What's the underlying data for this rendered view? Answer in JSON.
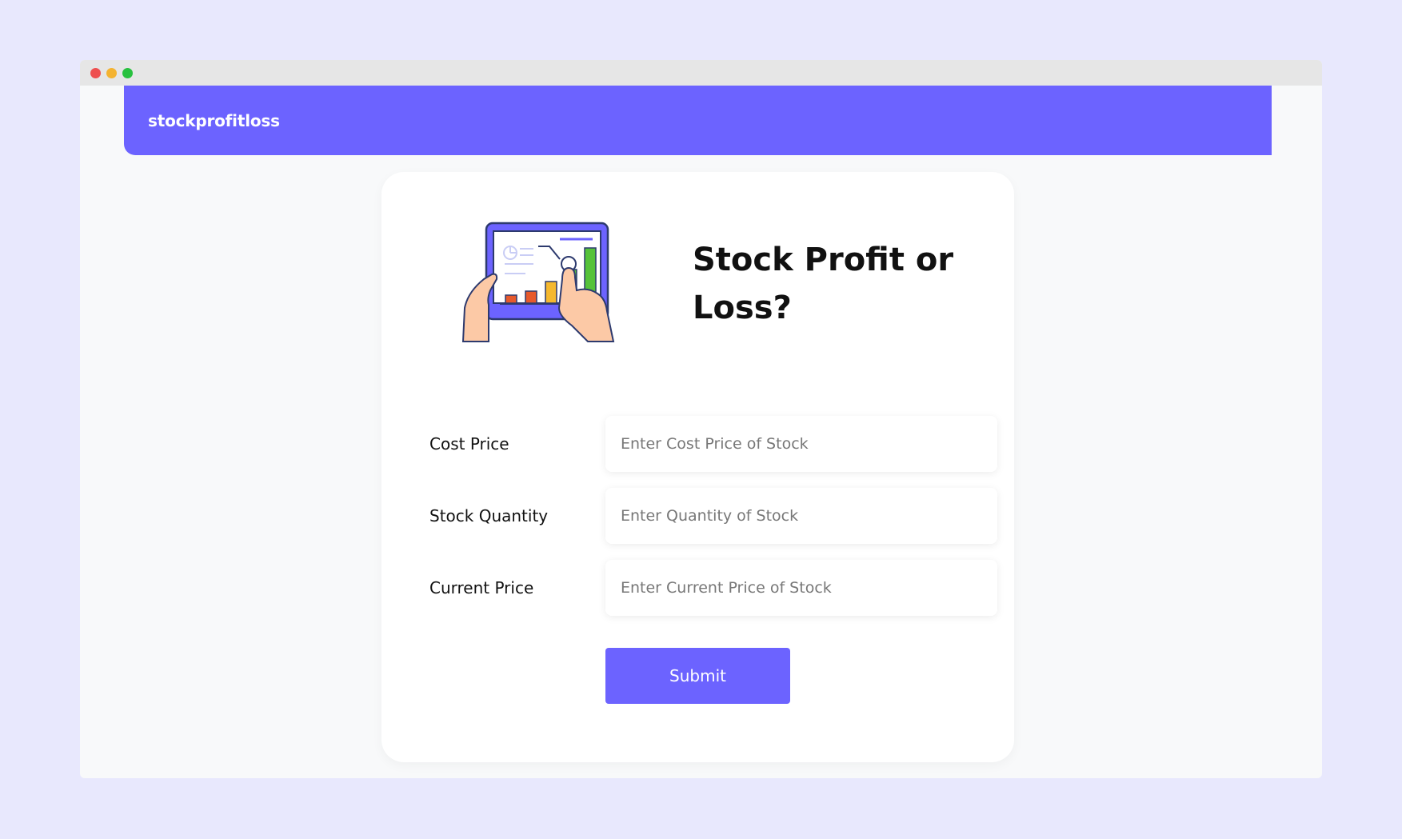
{
  "app": {
    "brand": "stockprofitloss"
  },
  "window_controls": {
    "icons": [
      "close-dot",
      "minimize-dot",
      "maximize-dot"
    ],
    "colors": [
      "#ee5050",
      "#f4b331",
      "#28c13f"
    ]
  },
  "theme": {
    "accent": "#6c63ff",
    "page_background": "#e8e8fd"
  },
  "card": {
    "title": "Stock Profit or Loss?",
    "illustration_icon": "tablet-chart-illustration"
  },
  "form": {
    "fields": [
      {
        "label": "Cost Price",
        "placeholder": "Enter Cost Price of Stock",
        "value": ""
      },
      {
        "label": "Stock Quantity",
        "placeholder": "Enter Quantity of Stock",
        "value": ""
      },
      {
        "label": "Current Price",
        "placeholder": "Enter Current Price of Stock",
        "value": ""
      }
    ],
    "submit_label": "Submit"
  }
}
